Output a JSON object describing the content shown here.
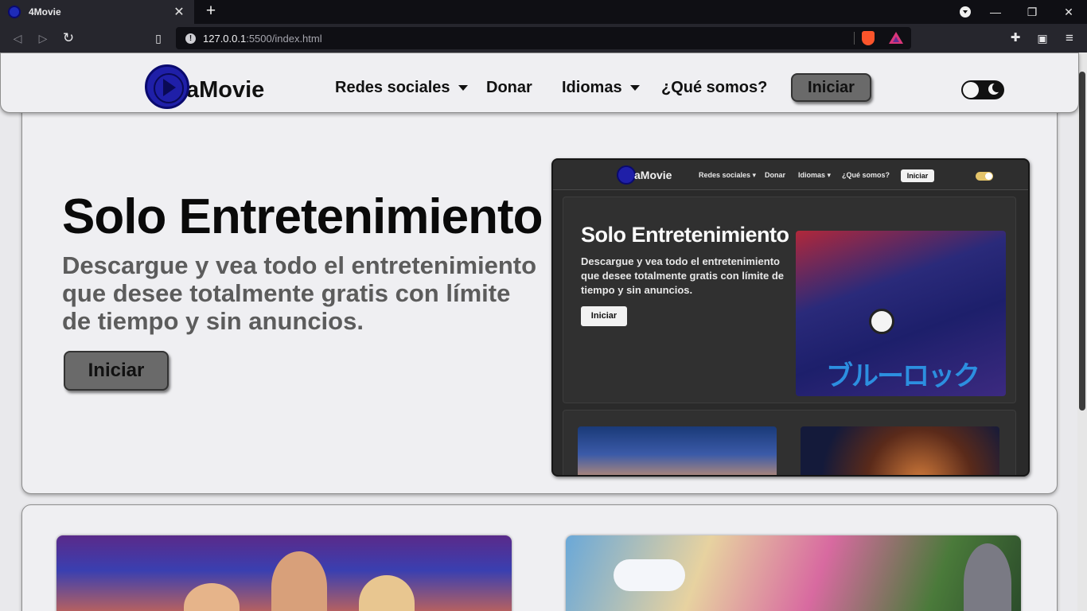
{
  "browser": {
    "tab_title": "4Movie",
    "tab_close": "✕",
    "new_tab": "+",
    "url_host": "127.0.0.1",
    "url_rest": ":5500/index.html",
    "url_info": "!",
    "window_controls": {
      "minimize": "—",
      "maximize": "❐",
      "close": "✕"
    },
    "toolbar_icons": [
      "back-icon",
      "forward-icon",
      "reload-icon",
      "bookmark-icon",
      "extensions-icon",
      "wallet-icon",
      "menu-icon"
    ]
  },
  "navbar": {
    "logo_text": "aMovie",
    "items": [
      {
        "label": "Redes sociales"
      },
      {
        "label": "Donar"
      },
      {
        "label": "Idiomas"
      },
      {
        "label": "¿Qué somos?"
      }
    ],
    "cta_label": "Iniciar"
  },
  "hero": {
    "title": "Solo Entretenimiento",
    "subtitle": "Descargue y vea todo el entretenimiento que desee totalmente gratis con límite de tiempo y sin anuncios.",
    "cta_label": "Iniciar"
  },
  "preview": {
    "logo_text": "aMovie",
    "nav_items": [
      "Redes sociales ▾",
      "Donar",
      "Idiomas ▾",
      "¿Qué somos?"
    ],
    "cta_label": "Iniciar",
    "title": "Solo Entretenimiento",
    "subtitle": "Descargue y vea todo el entretenimiento que desee totalmente gratis con límite de tiempo y sin anuncios.",
    "button_label": "Iniciar",
    "anime_text": "ブルーロック"
  },
  "colors": {
    "accent_blue": "#1f1fa8",
    "button_gray": "#6a6a6a",
    "page_bg": "#e9e9ec"
  }
}
